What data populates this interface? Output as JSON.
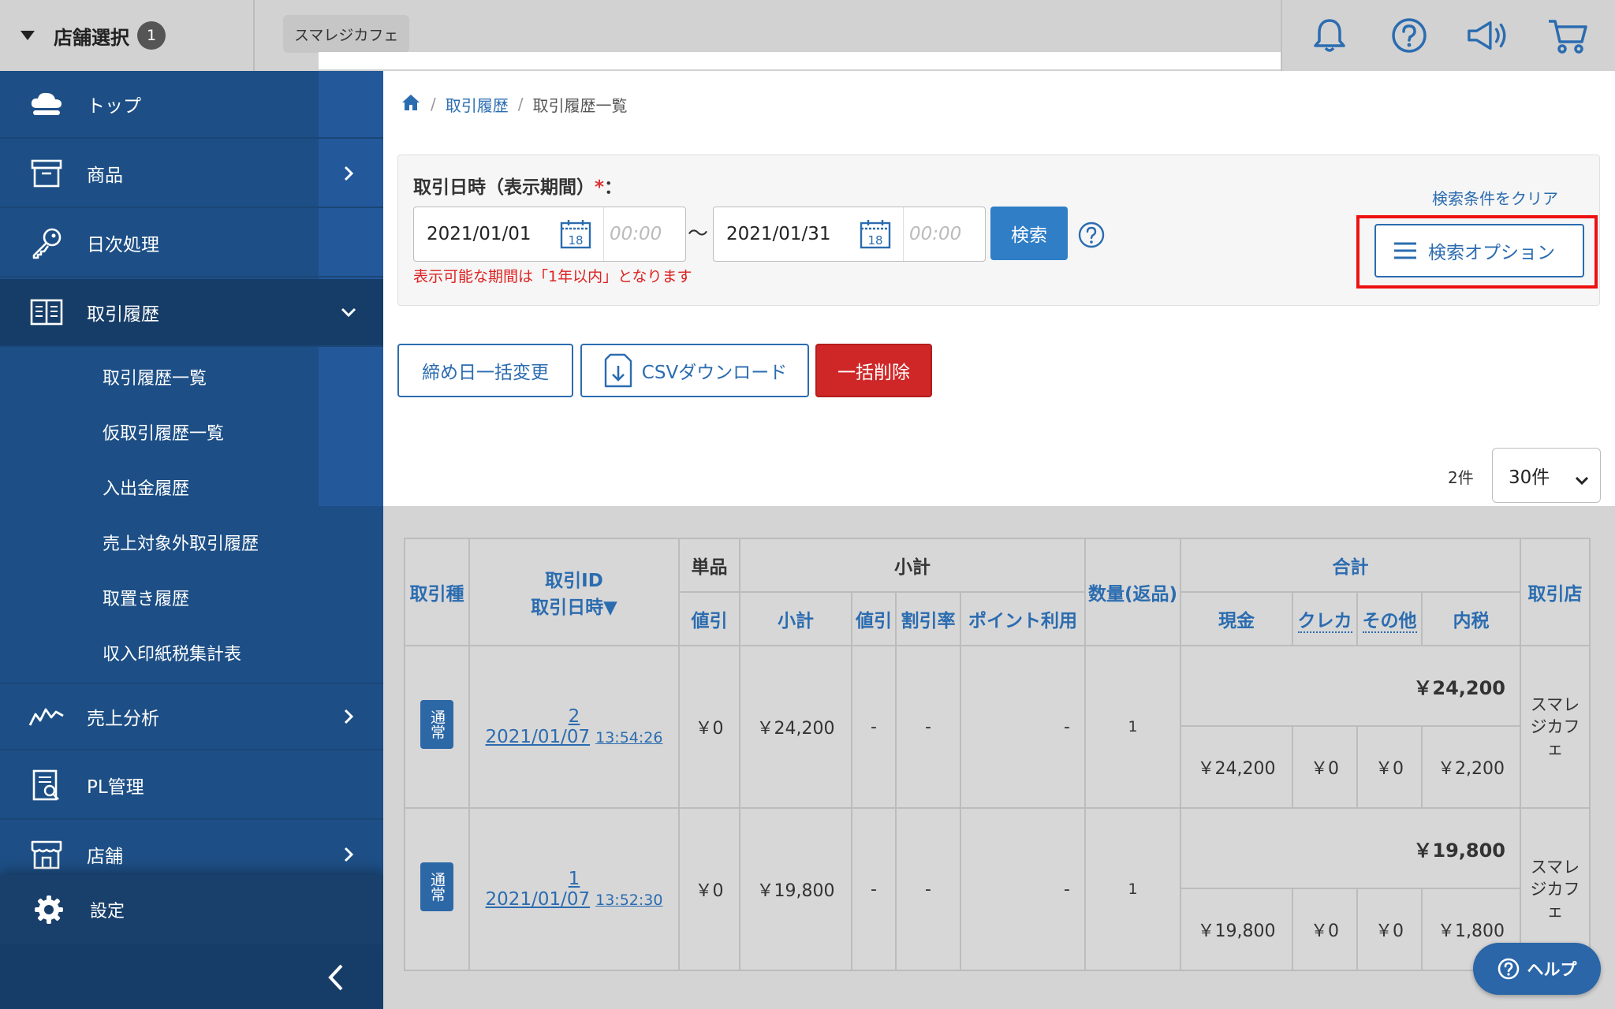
{
  "topbar": {
    "store_select_label": "店舗選択",
    "store_count": "1",
    "current_store": "スマレジカフェ"
  },
  "sidebar": {
    "items": [
      {
        "label": "トップ",
        "icon": "cloud-icon"
      },
      {
        "label": "商品",
        "icon": "box-icon"
      },
      {
        "label": "日次処理",
        "icon": "key-icon"
      },
      {
        "label": "取引履歴",
        "icon": "book-icon"
      },
      {
        "label": "売上分析",
        "icon": "chart-line-icon"
      },
      {
        "label": "PL管理",
        "icon": "report-icon"
      },
      {
        "label": "店舗",
        "icon": "store-icon"
      }
    ],
    "subitems": [
      "取引履歴一覧",
      "仮取引履歴一覧",
      "入出金履歴",
      "売上対象外取引履歴",
      "取置き履歴",
      "収入印紙税集計表"
    ],
    "settings_label": "設定"
  },
  "breadcrumb": {
    "level1": "取引履歴",
    "current": "取引履歴一覧"
  },
  "search": {
    "title": "取引日時（表示期間）",
    "required_mark": "*",
    "colon": "：",
    "start_date": "2021/01/01",
    "start_time_placeholder": "00:00",
    "end_date": "2021/01/31",
    "end_time_placeholder": "00:00",
    "calendar_day": "18",
    "tilde": "〜",
    "search_button": "検索",
    "note": "表示可能な期間は「1年以内」となります",
    "clear_link": "検索条件をクリア",
    "options_button": "検索オプション"
  },
  "actions": {
    "close_date_change": "締め日一括変更",
    "csv_download": "CSVダウンロード",
    "bulk_delete": "一括削除"
  },
  "pagination": {
    "count": "2件",
    "per_page": "30件"
  },
  "table": {
    "headers": {
      "type": "取引種",
      "id": "取引ID",
      "datetime": "取引日時▼",
      "item": "単品",
      "item_discount": "値引",
      "subtotal_group": "小計",
      "subtotal": "小計",
      "subtotal_discount": "値引",
      "discount_rate": "割引率",
      "points": "ポイント利用",
      "quantity": "数量(返品)",
      "total_group": "合計",
      "cash": "現金",
      "credit": "クレカ",
      "other": "その他",
      "tax": "内税",
      "store": "取引店"
    },
    "rows": [
      {
        "type": "通常",
        "id": "2",
        "date": "2021/01/07",
        "time": "13:54:26",
        "item_discount": "￥0",
        "subtotal": "￥24,200",
        "subtotal_discount": "-",
        "discount_rate": "-",
        "points": "-",
        "quantity": "1",
        "total": "￥24,200",
        "cash": "￥24,200",
        "credit": "￥0",
        "other": "￥0",
        "tax": "￥2,200",
        "store": "スマレジカフェ"
      },
      {
        "type": "通常",
        "id": "1",
        "date": "2021/01/07",
        "time": "13:52:30",
        "item_discount": "￥0",
        "subtotal": "￥19,800",
        "subtotal_discount": "-",
        "discount_rate": "-",
        "points": "-",
        "quantity": "1",
        "total": "￥19,800",
        "cash": "￥19,800",
        "credit": "￥0",
        "other": "￥0",
        "tax": "￥1,800",
        "store": "スマレジカフェ"
      }
    ]
  },
  "help_button": "ヘルプ",
  "colors": {
    "sidebar": "#1d4f86",
    "accent": "#2b6cb0",
    "danger": "#cf2727",
    "highlight": "#ee1111"
  }
}
